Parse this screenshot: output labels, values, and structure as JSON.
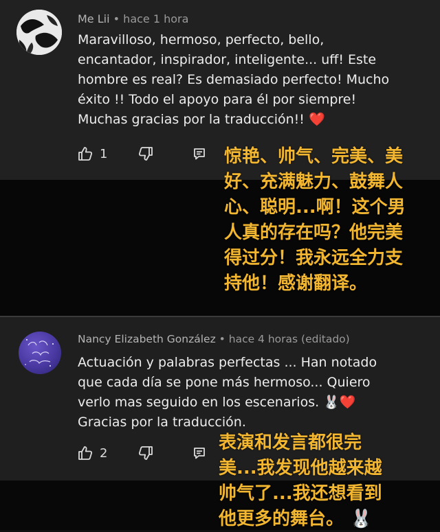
{
  "comments": [
    {
      "author": "Me Lii",
      "separator": "•",
      "time": "hace 1 hora",
      "lines": [
        "Maravilloso, hermoso, perfecto, bello,",
        "encantador, inspirador, inteligente... uff! Este",
        "hombre es real? Es demasiado perfecto! Mucho",
        "éxito !! Todo el apoyo para él por siempre!",
        "Muchas gracias por la traducción!!"
      ],
      "emoji": "❤️",
      "likes": "1",
      "translation_lines": [
        "惊艳、帅气、完美、美",
        "好、充满魅力、鼓舞人",
        "心、聪明...啊！这个男",
        "人真的存在吗？他完美",
        "得过分！我永远全力支",
        "持他！感谢翻译。"
      ]
    },
    {
      "author": "Nancy Elizabeth González",
      "separator": "•",
      "time": "hace 4 horas (editado)",
      "lines": [
        "Actuación y palabras perfectas  ... Han notado",
        "que cada día se pone más hermoso... Quiero",
        "verlo mas seguido en los escenarios.",
        "Gracias por la traducción."
      ],
      "emoji": "🐰❤️",
      "likes": "2",
      "translation_lines": [
        "表演和发言都很完",
        "美...我发现他越来越",
        "帅气了...我还想看到",
        "他更多的舞台。"
      ],
      "translation_emoji": "🐰"
    }
  ],
  "colors": {
    "comment_bg": "#212121",
    "page_bg": "#0f0f0f",
    "translation_text": "#f2b630",
    "meta_text": "#9a9a9a"
  },
  "icons": [
    "thumbs-up-icon",
    "thumbs-down-icon",
    "reply-icon"
  ]
}
